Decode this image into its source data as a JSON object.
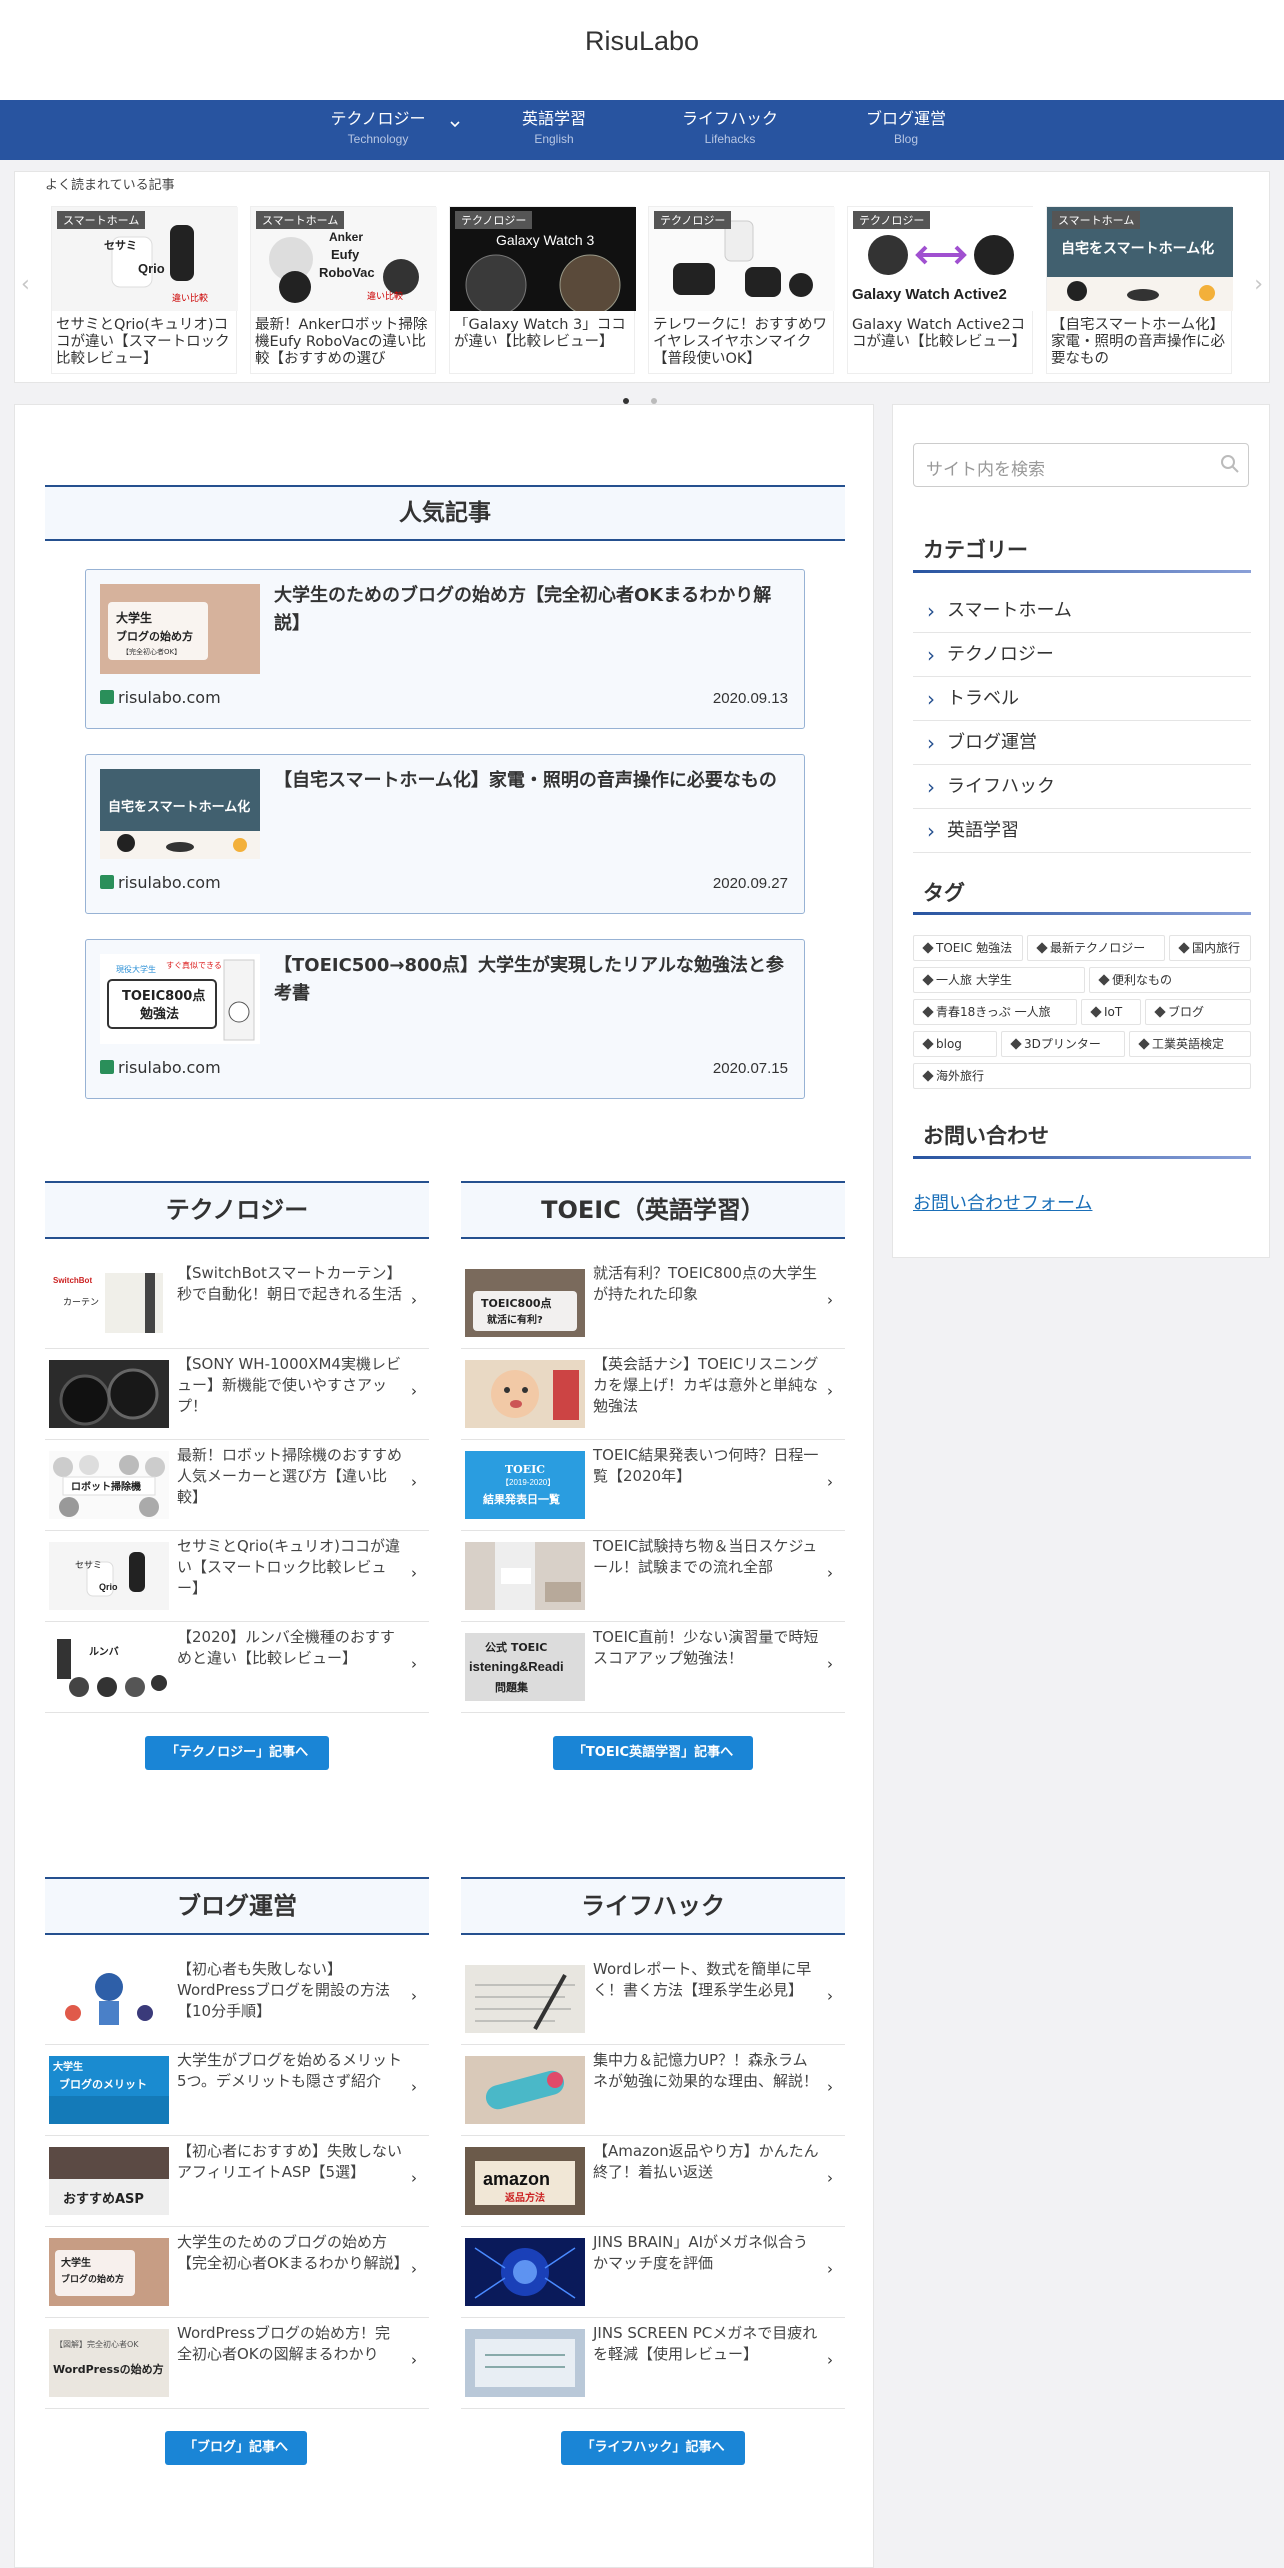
{
  "site": {
    "title": "RisuLabo"
  },
  "nav": [
    {
      "jp": "テクノロジー",
      "en": "Technology"
    },
    {
      "jp": "英語学習",
      "en": "English"
    },
    {
      "jp": "ライフハック",
      "en": "Lifehacks"
    },
    {
      "jp": "ブログ運営",
      "en": "Blog"
    }
  ],
  "carousel": {
    "heading": "よく読まれている記事",
    "cards": [
      {
        "badge": "スマートホーム",
        "title": "セサミとQrio(キュリオ)ココが違い【スマートロック比較レビュー】",
        "thumb_text": "セサミ Qrio"
      },
      {
        "badge": "スマートホーム",
        "title": "最新！Ankerロボット掃除機Eufy RoboVacの違い比較【おすすめの選び",
        "thumb_text": "Anker Eufy RoboVac"
      },
      {
        "badge": "テクノロジー",
        "title": "「Galaxy Watch 3」ココが違い【比較レビュー】",
        "thumb_text": "Galaxy Watch 3"
      },
      {
        "badge": "テクノロジー",
        "title": "テレワークに！おすすめワイヤレスイヤホンマイク【普段使いOK】",
        "thumb_text": ""
      },
      {
        "badge": "テクノロジー",
        "title": "Galaxy Watch Active2ココが違い【比較レビュー】",
        "thumb_text": "Galaxy Watch Active2"
      },
      {
        "badge": "スマートホーム",
        "title": "【自宅スマートホーム化】家電・照明の音声操作に必要なもの",
        "thumb_text": "自宅をスマートホーム化"
      }
    ]
  },
  "popular": {
    "heading": "人気記事",
    "items": [
      {
        "title": "大学生のためのブログの始め方【完全初心者OKまるわかり解説】",
        "site": "risulabo.com",
        "date": "2020.09.13",
        "thumb_text": "大学生 ブログの始め方"
      },
      {
        "title": "【自宅スマートホーム化】家電・照明の音声操作に必要なもの",
        "site": "risulabo.com",
        "date": "2020.09.27",
        "thumb_text": "自宅をスマートホーム化"
      },
      {
        "title": "【TOEIC500→800点】大学生が実現したリアルな勉強法と参考書",
        "site": "risulabo.com",
        "date": "2020.07.15",
        "thumb_text": "TOEIC800点 勉強法"
      }
    ]
  },
  "sections": [
    {
      "heading": "テクノロジー",
      "button": "「テクノロジー」記事へ",
      "items": [
        {
          "title": "【SwitchBotスマートカーテン】秒で自動化！朝日で起きれる生活"
        },
        {
          "title": "【SONY WH-1000XM4実機レビュー】新機能で使いやすさアップ！"
        },
        {
          "title": "最新！ロボット掃除機のおすすめ人気メーカーと選び方【違い比較】"
        },
        {
          "title": "セサミとQrio(キュリオ)ココが違い【スマートロック比較レビュー】"
        },
        {
          "title": "【2020】ルンバ全機種のおすすめと違い【比較レビュー】"
        }
      ]
    },
    {
      "heading": "TOEIC（英語学習）",
      "button": "「TOEIC英語学習」記事へ",
      "items": [
        {
          "title": "就活有利？TOEIC800点の大学生が持たれた印象"
        },
        {
          "title": "【英会話ナシ】TOEICリスニングカを爆上げ！カギは意外と単純な勉強法"
        },
        {
          "title": "TOEIC結果発表いつ何時？日程一覧【2020年】"
        },
        {
          "title": "TOEIC試験持ち物＆当日スケジュール！試験までの流れ全部"
        },
        {
          "title": "TOEIC直前！少ない演習量で時短スコアアップ勉強法！"
        }
      ]
    },
    {
      "heading": "ブログ運営",
      "button": "「ブログ」記事へ",
      "items": [
        {
          "title": "【初心者も失敗しない】WordPressブログを開設の方法【10分手順】"
        },
        {
          "title": "大学生がブログを始めるメリット5つ。デメリットも隠さず紹介"
        },
        {
          "title": "【初心者におすすめ】失敗しないアフィリエイトASP【5選】"
        },
        {
          "title": "大学生のためのブログの始め方【完全初心者OKまるわかり解説】"
        },
        {
          "title": "WordPressブログの始め方！完全初心者OKの図解まるわかり"
        }
      ]
    },
    {
      "heading": "ライフハック",
      "button": "「ライフハック」記事へ",
      "items": [
        {
          "title": "Wordレポート、数式を簡単に早く！書く方法【理系学生必見】"
        },
        {
          "title": "集中力＆記憶力UP？！森永ラムネが勉強に効果的な理由、解説！"
        },
        {
          "title": "【Amazon返品やり方】かんたん終了！着払い返送"
        },
        {
          "title": "JINS BRAIN」AIがメガネ似合うかマッチ度を評価"
        },
        {
          "title": "JINS SCREEN PCメガネで目疲れを軽減【使用レビュー】"
        }
      ]
    }
  ],
  "sidebar": {
    "search_placeholder": "サイト内を検索",
    "categories_heading": "カテゴリー",
    "categories": [
      "スマートホーム",
      "テクノロジー",
      "トラベル",
      "ブログ運営",
      "ライフハック",
      "英語学習"
    ],
    "tags_heading": "タグ",
    "tags": [
      "TOEIC 勉強法",
      "最新テクノロジー",
      "国内旅行",
      "一人旅 大学生",
      "便利なもの",
      "青春18きっぷ 一人旅",
      "IoT",
      "ブログ",
      "blog",
      "3Dプリンター",
      "工業英語検定",
      "海外旅行"
    ],
    "contact_heading": "お問い合わせ",
    "contact_link": "お問い合わせフォーム"
  }
}
